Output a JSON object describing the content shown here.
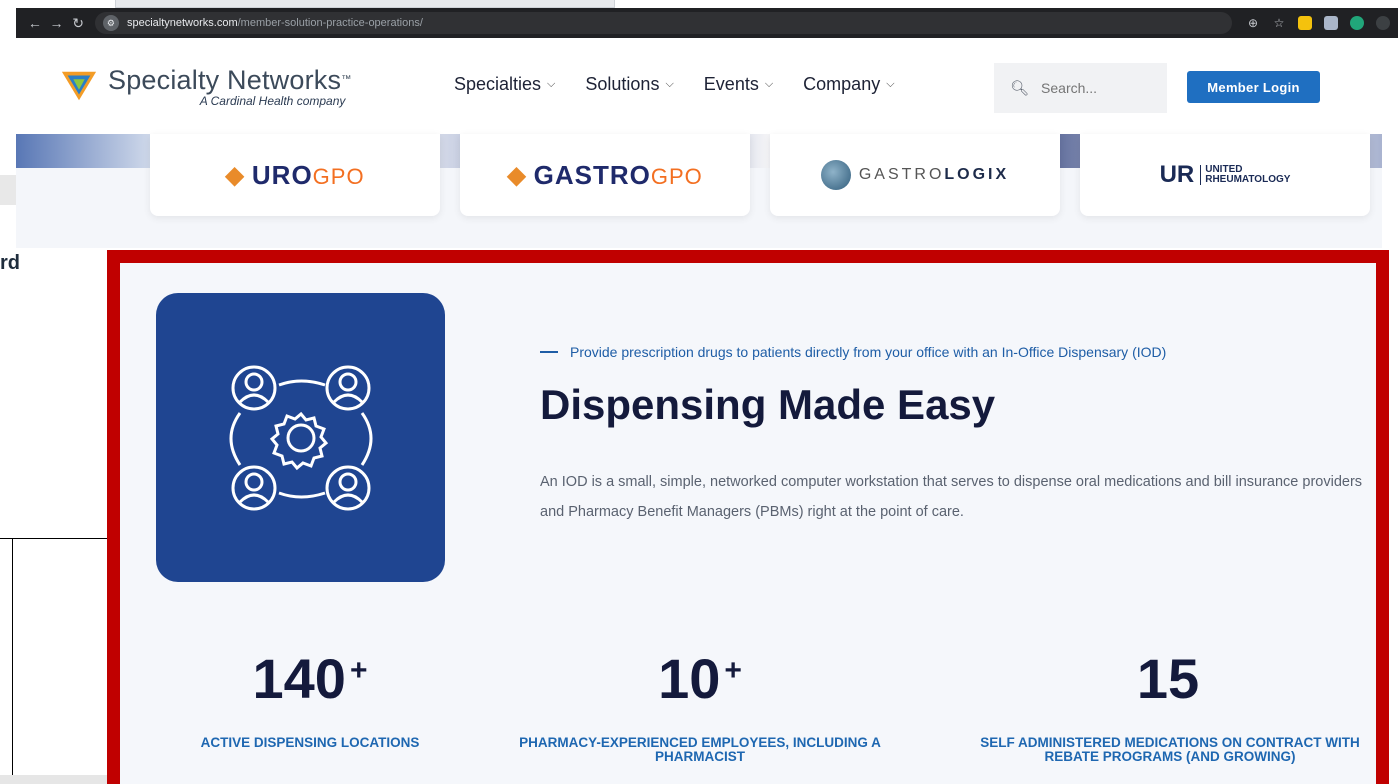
{
  "browser": {
    "url_host": "specialtynetworks.com",
    "url_path": "/member-solution-practice-operations/"
  },
  "background_window": {
    "fragment_text": "rd"
  },
  "header": {
    "logo_name": "Specialty Networks",
    "logo_tm": "™",
    "logo_sub": "A Cardinal Health company",
    "nav": [
      {
        "label": "Specialties"
      },
      {
        "label": "Solutions"
      },
      {
        "label": "Events"
      },
      {
        "label": "Company"
      }
    ],
    "search_placeholder": "Search...",
    "login_label": "Member Login"
  },
  "partners": {
    "uro_main": "URO",
    "uro_gpo": "GPO",
    "gastro_main": "GASTRO",
    "gastro_gpo": "GPO",
    "glogix_light": "GASTRO",
    "glogix_bold": "LOGIX",
    "ur_mark": "UR",
    "ur_line1": "UNITED",
    "ur_line2": "RHEUMATOLOGY"
  },
  "section": {
    "tagline": "Provide prescription drugs to patients directly from your office with an In-Office Dispensary (IOD)",
    "headline": "Dispensing Made Easy",
    "body": "An IOD is a small, simple, networked computer workstation that serves to dispense oral medications and bill insurance providers and Pharmacy Benefit Managers (PBMs) right at the point of care.",
    "icon_name": "users-gear-network-icon"
  },
  "stats": [
    {
      "number": "140",
      "suffix": "+",
      "label": "ACTIVE DISPENSING LOCATIONS"
    },
    {
      "number": "10",
      "suffix": "+",
      "label": "PHARMACY-EXPERIENCED EMPLOYEES, INCLUDING A PHARMACIST"
    },
    {
      "number": "15",
      "suffix": "",
      "label": "SELF ADMINISTERED MEDICATIONS ON CONTRACT WITH REBATE PROGRAMS (AND GROWING)"
    }
  ],
  "colors": {
    "highlight_border": "#c00000",
    "icon_tile": "#1f4591",
    "accent_blue": "#1e67b1",
    "login_button": "#1f6fc1",
    "headline": "#141a3c"
  }
}
